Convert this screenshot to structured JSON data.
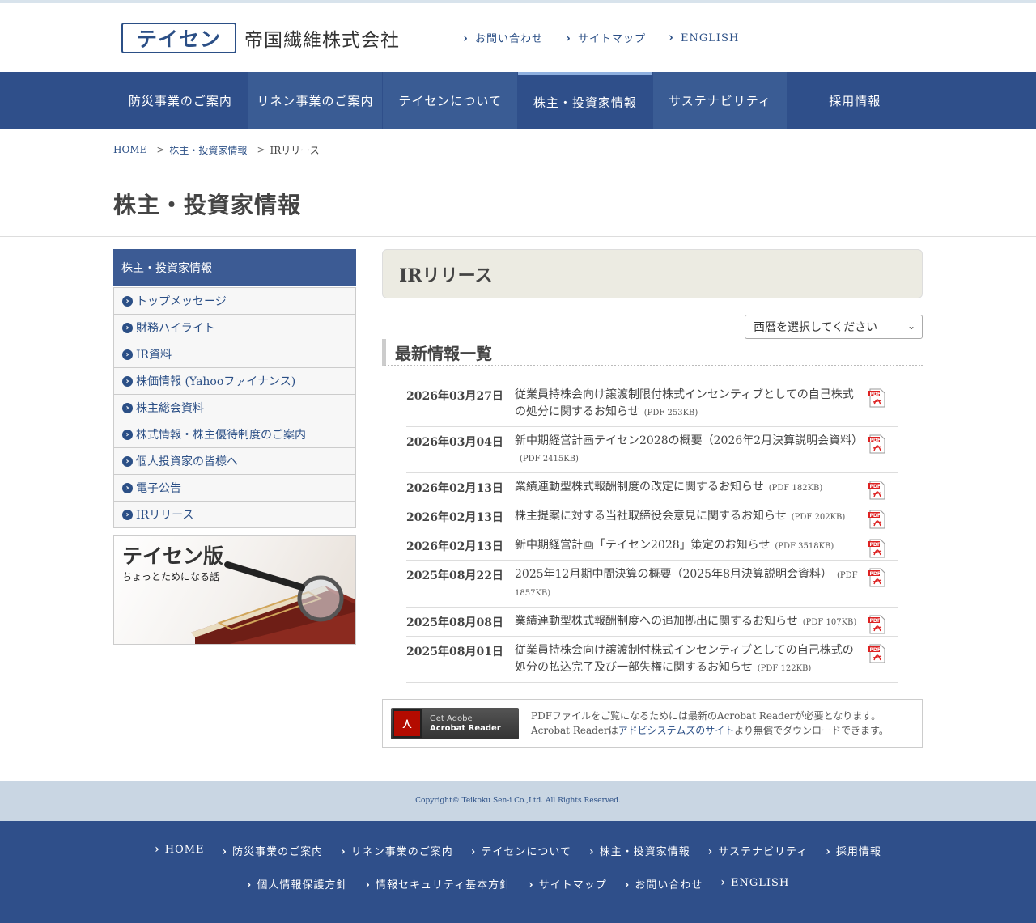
{
  "header": {
    "logo_mark": "テイセン",
    "company_name": "帝国繊維株式会社",
    "links": [
      "お問い合わせ",
      "サイトマップ",
      "ENGLISH"
    ]
  },
  "gnav": [
    "防災事業のご案内",
    "リネン事業のご案内",
    "テイセンについて",
    "株主・投資家情報",
    "サステナビリティ",
    "採用情報"
  ],
  "breadcrumb": {
    "home": "HOME",
    "parent": "株主・投資家情報",
    "current": "IRリリース",
    "sep": ">"
  },
  "page_title": "株主・投資家情報",
  "sidebar": {
    "heading": "株主・投資家情報",
    "items": [
      "トップメッセージ",
      "財務ハイライト",
      "IR資料",
      "株価情報 (Yahooファイナンス)",
      "株主総会資料",
      "株式情報・株主優待制度のご案内",
      "個人投資家の皆様へ",
      "電子公告",
      "IRリリース"
    ],
    "banner_title": "テイセン版",
    "banner_sub": "ちょっとためになる話"
  },
  "content": {
    "heading": "IRリリース",
    "year_select": "西暦を選択してください",
    "list_heading": "最新情報一覧",
    "news": [
      {
        "date": "2026年03月27日",
        "title": "従業員持株会向け譲渡制限付株式インセンティブとしての自己株式の処分に関するお知らせ",
        "size": "(PDF 253KB)"
      },
      {
        "date": "2026年03月04日",
        "title": "新中期経営計画テイセン2028の概要（2026年2月決算説明会資料）",
        "size": "(PDF 2415KB)"
      },
      {
        "date": "2026年02月13日",
        "title": "業績連動型株式報酬制度の改定に関するお知らせ",
        "size": "(PDF 182KB)"
      },
      {
        "date": "2026年02月13日",
        "title": "株主提案に対する当社取締役会意見に関するお知らせ",
        "size": "(PDF 202KB)"
      },
      {
        "date": "2026年02月13日",
        "title": "新中期経営計画「テイセン2028」策定のお知らせ",
        "size": "(PDF 3518KB)"
      },
      {
        "date": "2025年08月22日",
        "title": "2025年12月期中間決算の概要（2025年8月決算説明会資料）",
        "size": "(PDF 1857KB)"
      },
      {
        "date": "2025年08月08日",
        "title": "業績連動型株式報酬制度への追加拠出に関するお知らせ",
        "size": "(PDF 107KB)"
      },
      {
        "date": "2025年08月01日",
        "title": "従業員持株会向け譲渡制付株式インセンティブとしての自己株式の処分の払込完了及び一部失権に関するお知らせ",
        "size": "(PDF 122KB)"
      }
    ],
    "acrobat": {
      "btn_line1": "Get Adobe",
      "btn_line2": "Acrobat Reader",
      "note_pre": "PDFファイルをご覧になるためには最新のAcrobat Readerが必要となります。Acrobat Readerは",
      "note_link": "アドビシステムズのサイト",
      "note_post": "より無償でダウンロードできます。"
    }
  },
  "footer": {
    "copyright": "Copyright© Teikoku Sen-i Co.,Ltd. All Rights Reserved.",
    "row1": [
      "HOME",
      "防災事業のご案内",
      "リネン事業のご案内",
      "テイセンについて",
      "株主・投資家情報",
      "サステナビリティ",
      "採用情報"
    ],
    "row2": [
      "個人情報保護方針",
      "情報セキュリティ基本方針",
      "サイトマップ",
      "お問い合わせ",
      "ENGLISH"
    ]
  },
  "colors": {
    "brand": "#2f4f8a",
    "sidebar_head": "#3c5b94",
    "ir_head_bg": "#ecebe2",
    "pdf_red": "#d22"
  }
}
